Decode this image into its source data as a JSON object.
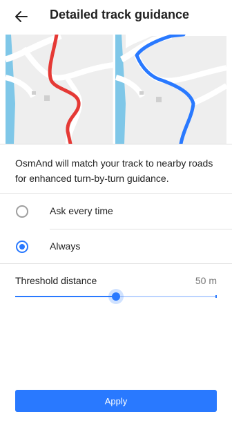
{
  "header": {
    "title": "Detailed track guidance",
    "back_icon": "arrow-back-icon"
  },
  "illustration": {
    "left_route_color": "#e53935",
    "right_route_color": "#2979ff",
    "water_color": "#7fc7e8",
    "map_bg_color": "#eeeeee"
  },
  "description": "OsmAnd will match your track to nearby roads for enhanced turn-by-turn guidance.",
  "options": [
    {
      "label": "Ask every time",
      "selected": false
    },
    {
      "label": "Always",
      "selected": true
    }
  ],
  "threshold": {
    "label": "Threshold distance",
    "value": "50 m",
    "slider_fraction": 0.5
  },
  "apply_label": "Apply",
  "colors": {
    "accent": "#2979ff",
    "text": "#212121",
    "secondary_text": "#757575",
    "divider": "#e0e0e0"
  }
}
